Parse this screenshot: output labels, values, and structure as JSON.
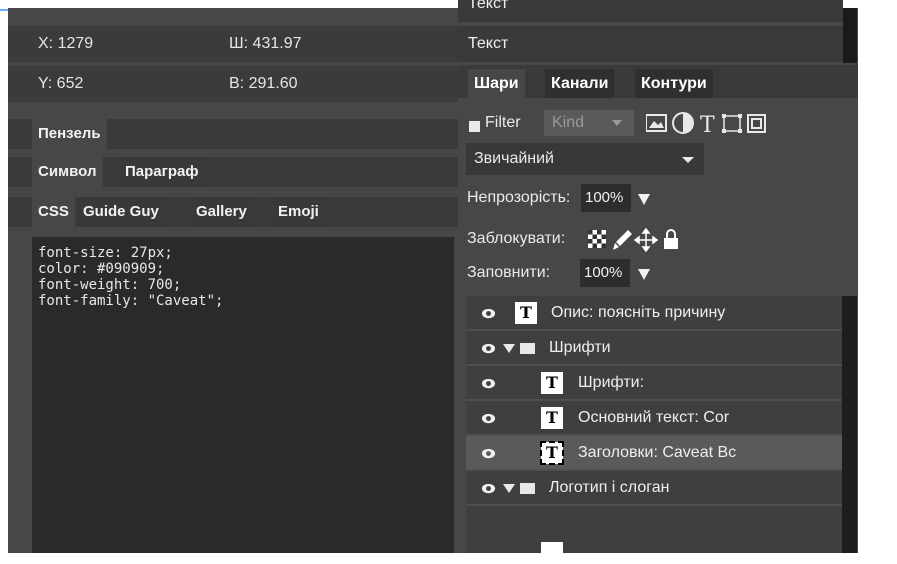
{
  "transform": {
    "x_label": "X: 1279",
    "w_label": "Ш: 431.97",
    "y_label": "Y: 652",
    "h_label": "В: 291.60"
  },
  "left_tabs": {
    "brush": "Пензель",
    "symbol": "Символ",
    "paragraph": "Параграф",
    "css": "CSS",
    "guide_guy": "Guide Guy",
    "gallery": "Gallery",
    "emoji": "Emoji"
  },
  "css_lines": [
    "font-size: 27px;",
    "color: #090909;",
    "font-weight: 700;",
    "font-family: \"Caveat\";"
  ],
  "right": {
    "text_row_top": "Текст",
    "text_row": "Текст",
    "tabs": [
      "Шари",
      "Канали",
      "Контури"
    ],
    "filter_label": "Filter",
    "kind_label": "Kind",
    "blend_mode": "Звичайний",
    "opacity_label": "Непрозорість:",
    "opacity_value": "100%",
    "lock_label": "Заблокувати:",
    "fill_label": "Заповнити:",
    "fill_value": "100%"
  },
  "layers": [
    {
      "name": "Опис: поясніть причину",
      "type": "text",
      "indent": 0
    },
    {
      "name": "Шрифти",
      "type": "group",
      "indent": 0
    },
    {
      "name": "Шрифти:",
      "type": "text",
      "indent": 1
    },
    {
      "name": "Основний текст: Cor",
      "type": "text",
      "indent": 1
    },
    {
      "name": "Заголовки: Caveat Bc",
      "type": "text",
      "indent": 1,
      "selected": true
    },
    {
      "name": "Логотип і слоган",
      "type": "group",
      "indent": 0
    }
  ],
  "colors": {
    "panel_bg": "#474747",
    "dark_bg": "#3a3a3a",
    "code_bg": "#2a2a2a",
    "selected_layer": "#5a5a5a"
  }
}
